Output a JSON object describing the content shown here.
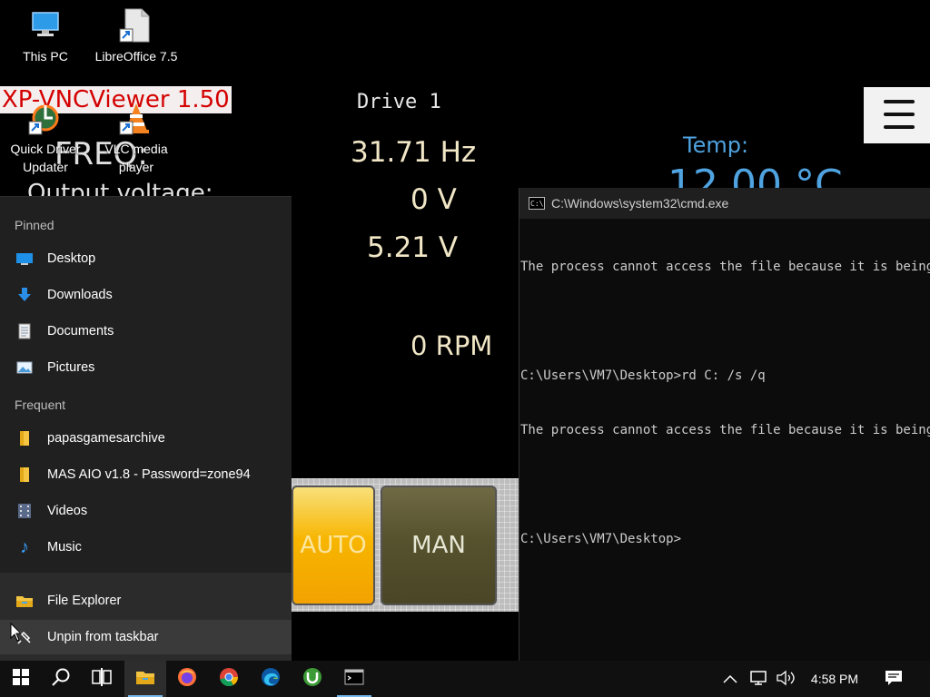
{
  "desktop": {
    "icons": [
      {
        "label": "This PC",
        "icon": "this-pc-icon"
      },
      {
        "label": "LibreOffice 7.5",
        "icon": "libreoffice-icon"
      },
      {
        "label": "Quick Driver Updater",
        "icon": "quick-driver-updater-icon"
      },
      {
        "label": "VLC media player",
        "icon": "vlc-icon"
      }
    ]
  },
  "vnc": {
    "title": "XP-VNCViewer 1.50",
    "drive_label": "Drive 1",
    "freq_label": "FREQ:",
    "output_voltage_label": "Output voltage:",
    "freq_value": "31.71 Hz",
    "voltage_value": "0 V",
    "voltage2_value": "5.21 V",
    "rpm_value": "0 RPM",
    "temp_label": "Temp:",
    "temp_value": "12.00 °C",
    "auto_button": "AUTO",
    "man_button": "MAN"
  },
  "jumplist": {
    "pinned_heading": "Pinned",
    "pinned": [
      {
        "label": "Desktop",
        "icon": "desktop-icon"
      },
      {
        "label": "Downloads",
        "icon": "downloads-icon"
      },
      {
        "label": "Documents",
        "icon": "documents-icon"
      },
      {
        "label": "Pictures",
        "icon": "pictures-icon"
      }
    ],
    "frequent_heading": "Frequent",
    "frequent": [
      {
        "label": "papasgamesarchive",
        "icon": "folder-icon"
      },
      {
        "label": "MAS AIO v1.8 - Password=zone94",
        "icon": "folder-icon"
      },
      {
        "label": "Videos",
        "icon": "videos-icon"
      },
      {
        "label": "Music",
        "icon": "music-icon"
      }
    ],
    "file_explorer": "File Explorer",
    "unpin": "Unpin from taskbar"
  },
  "cmd": {
    "title": "C:\\Windows\\system32\\cmd.exe",
    "lines": [
      "The process cannot access the file because it is being used by another process.",
      "",
      "C:\\Users\\VM7\\Desktop>rd C: /s /q",
      "The process cannot access the file because it is being used by another process.",
      "",
      "C:\\Users\\VM7\\Desktop>"
    ]
  },
  "taskbar": {
    "clock": "4:58 PM",
    "apps": [
      "start-icon",
      "search-icon",
      "task-view-icon",
      "file-explorer-icon",
      "firefox-icon",
      "chrome-icon",
      "edge-icon",
      "utorrent-icon",
      "cmd-icon"
    ]
  },
  "colors": {
    "accent": "#76b9ed",
    "vnc_title_red": "#d40000",
    "temp_blue": "#4fa3e0",
    "auto_orange": "#f7b500"
  }
}
